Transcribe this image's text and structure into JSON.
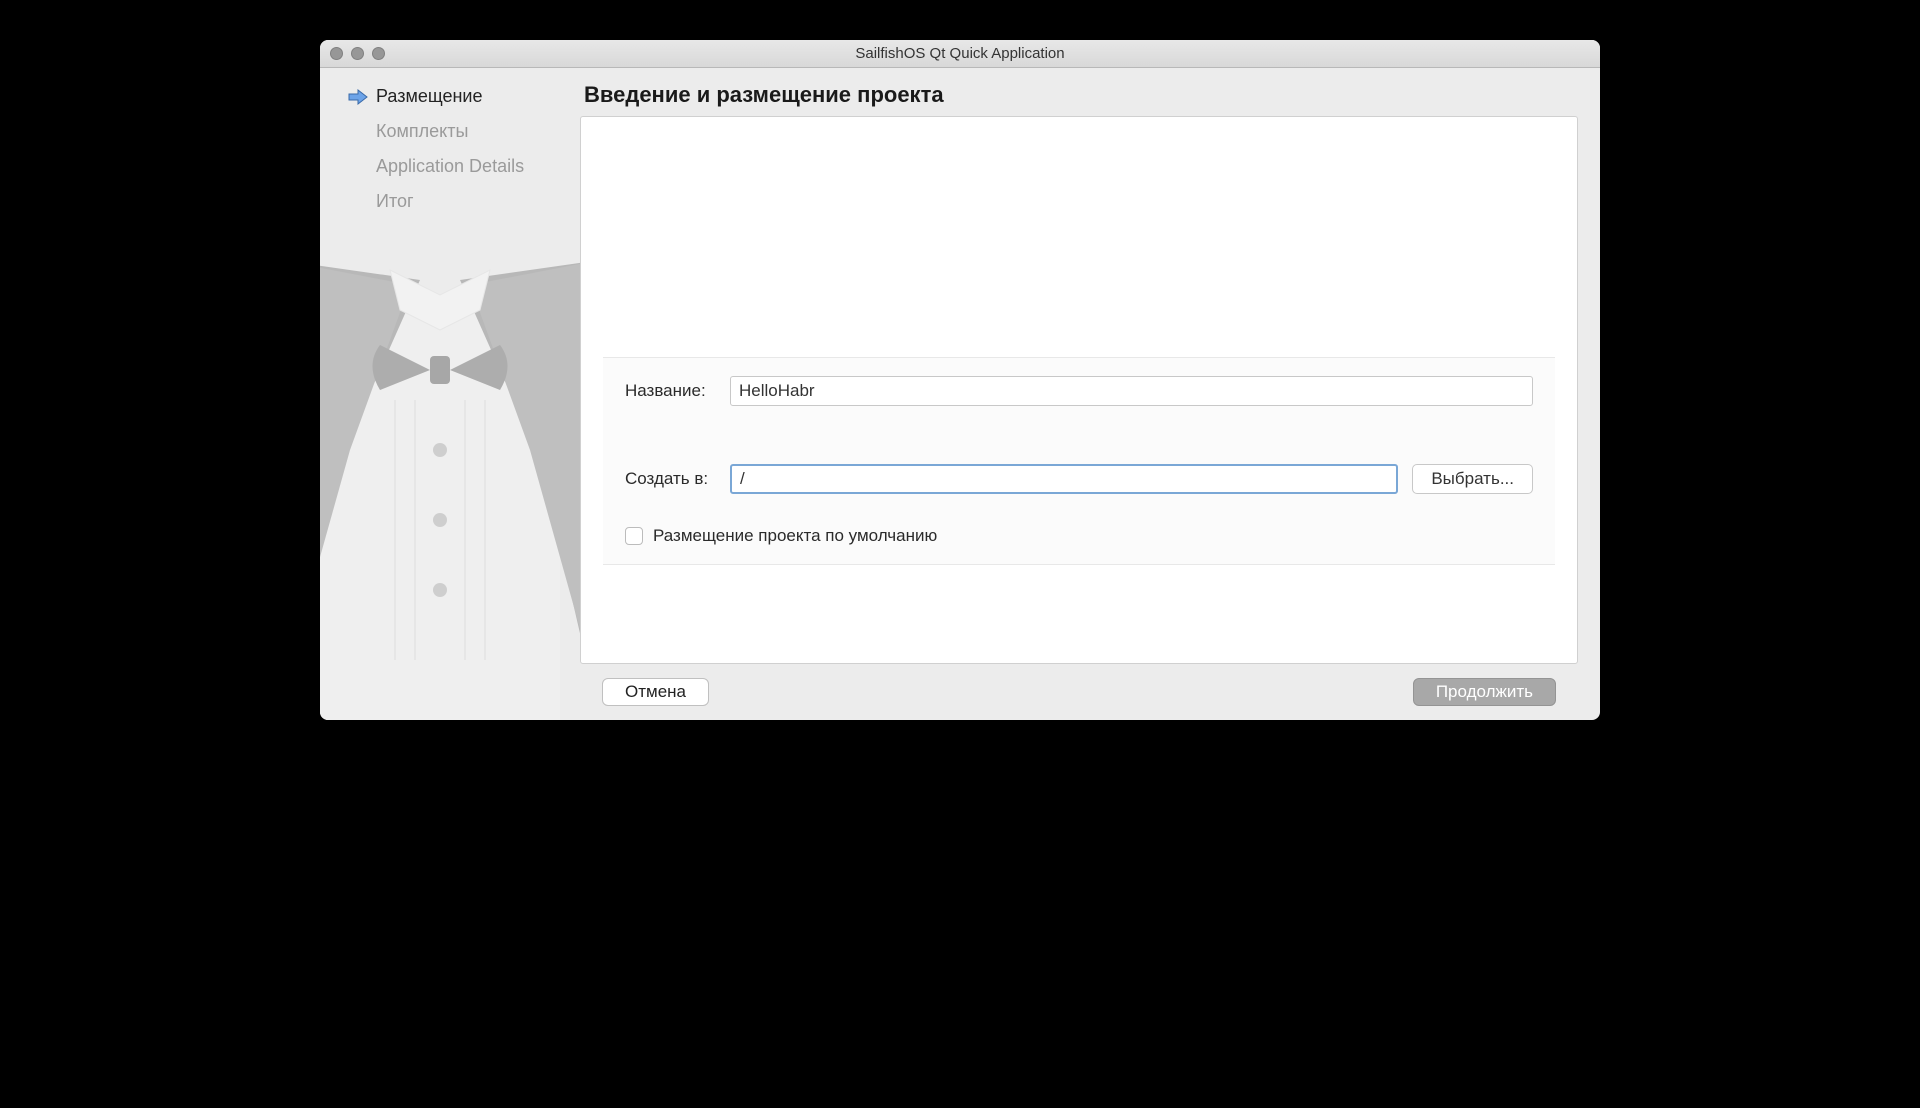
{
  "window": {
    "title": "SailfishOS Qt Quick Application"
  },
  "sidebar": {
    "steps": [
      {
        "label": "Размещение",
        "active": true
      },
      {
        "label": "Комплекты",
        "active": false
      },
      {
        "label": "Application Details",
        "active": false
      },
      {
        "label": "Итог",
        "active": false
      }
    ]
  },
  "main": {
    "heading": "Введение и размещение проекта",
    "fields": {
      "name_label": "Название:",
      "name_value": "HelloHabr",
      "create_in_label": "Создать в:",
      "create_in_value": "/",
      "browse_label": "Выбрать...",
      "default_location_label": "Размещение проекта по умолчанию"
    }
  },
  "footer": {
    "cancel_label": "Отмена",
    "continue_label": "Продолжить"
  }
}
